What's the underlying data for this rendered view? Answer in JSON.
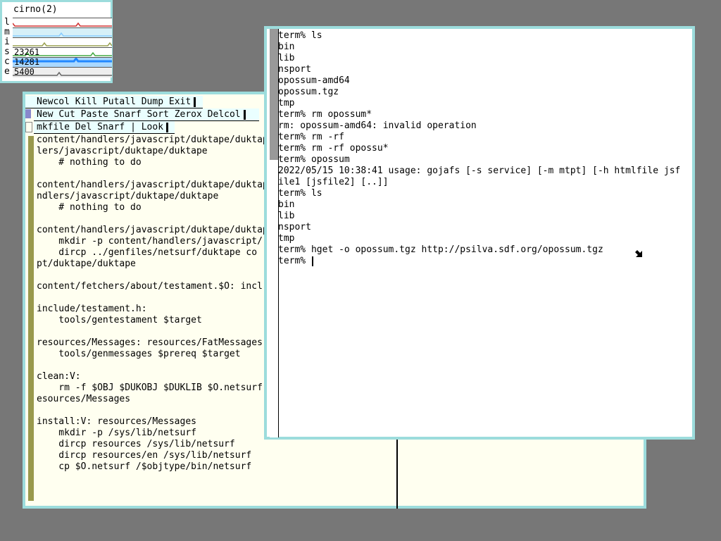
{
  "stats": {
    "title": "cirno(2)",
    "rows": [
      {
        "label": "l",
        "value": "",
        "color": "#d03030",
        "bg": "#ffffff"
      },
      {
        "label": "m",
        "value": "",
        "color": "#88ccff",
        "bg": "#d6f0f8"
      },
      {
        "label": "i",
        "value": "",
        "color": "#9aa050",
        "bg": "#ffffff"
      },
      {
        "label": "s",
        "value": "23261",
        "color": "#44aa44",
        "bg": "#ffffff"
      },
      {
        "label": "c",
        "value": "14281",
        "color": "#2288ff",
        "bg": "#aad8ff"
      },
      {
        "label": "e",
        "value": "5400",
        "color": "#666666",
        "bg": "#eeeeee"
      }
    ]
  },
  "acme": {
    "col_tag": [
      "Newcol",
      "Kill",
      "Putall",
      "Dump",
      "Exit"
    ],
    "win_tag": [
      "New",
      "Cut",
      "Paste",
      "Snarf",
      "Sort",
      "Zerox",
      "Delcol"
    ],
    "file_tag": [
      "mkfile",
      "Del",
      "Snarf",
      "|",
      "Look"
    ],
    "body_lines": [
      "content/handlers/javascript/duktape/duktape",
      "lers/javascript/duktape/duktape",
      "    # nothing to do",
      "",
      "content/handlers/javascript/duktape/duktape",
      "ndlers/javascript/duktape/duktape",
      "    # nothing to do",
      "",
      "content/handlers/javascript/duktape/duktape",
      "    mkdir -p content/handlers/javascript/",
      "    dircp ../genfiles/netsurf/duktape co",
      "pt/duktape/duktape",
      "",
      "content/fetchers/about/testament.$O: incl",
      "",
      "include/testament.h:",
      "    tools/gentestament $target",
      "",
      "resources/Messages: resources/FatMessages",
      "    tools/genmessages $prereq $target",
      "",
      "clean:V:",
      "    rm -f $OBJ $DUKOBJ $DUKLIB $O.netsurf",
      "esources/Messages",
      "",
      "install:V: resources/Messages",
      "    mkdir -p /sys/lib/netsurf",
      "    dircp resources /sys/lib/netsurf",
      "    dircp resources/en /sys/lib/netsurf",
      "    cp $O.netsurf /$objtype/bin/netsurf"
    ]
  },
  "terminal": {
    "lines": [
      "term% ls",
      "bin",
      "lib",
      "nsport",
      "opossum-amd64",
      "opossum.tgz",
      "tmp",
      "term% rm opossum*",
      "rm: opossum-amd64: invalid operation",
      "term% rm -rf",
      "term% rm -rf opossu*",
      "term% opossum",
      "2022/05/15 10:38:41 usage: gojafs [-s service] [-m mtpt] [-h htmlfile jsf",
      "ile1 [jsfile2] [..]]",
      "term% ls",
      "bin",
      "lib",
      "nsport",
      "tmp",
      "term% hget -o opossum.tgz http://psilva.sdf.org/opossum.tgz"
    ],
    "prompt": "term% "
  },
  "colors": {
    "desktop": "#777777",
    "border": "#9cdcdc",
    "acme_body": "#fffff0",
    "acme_tag": "#eaffff",
    "acme_scroll": "#99994c"
  }
}
